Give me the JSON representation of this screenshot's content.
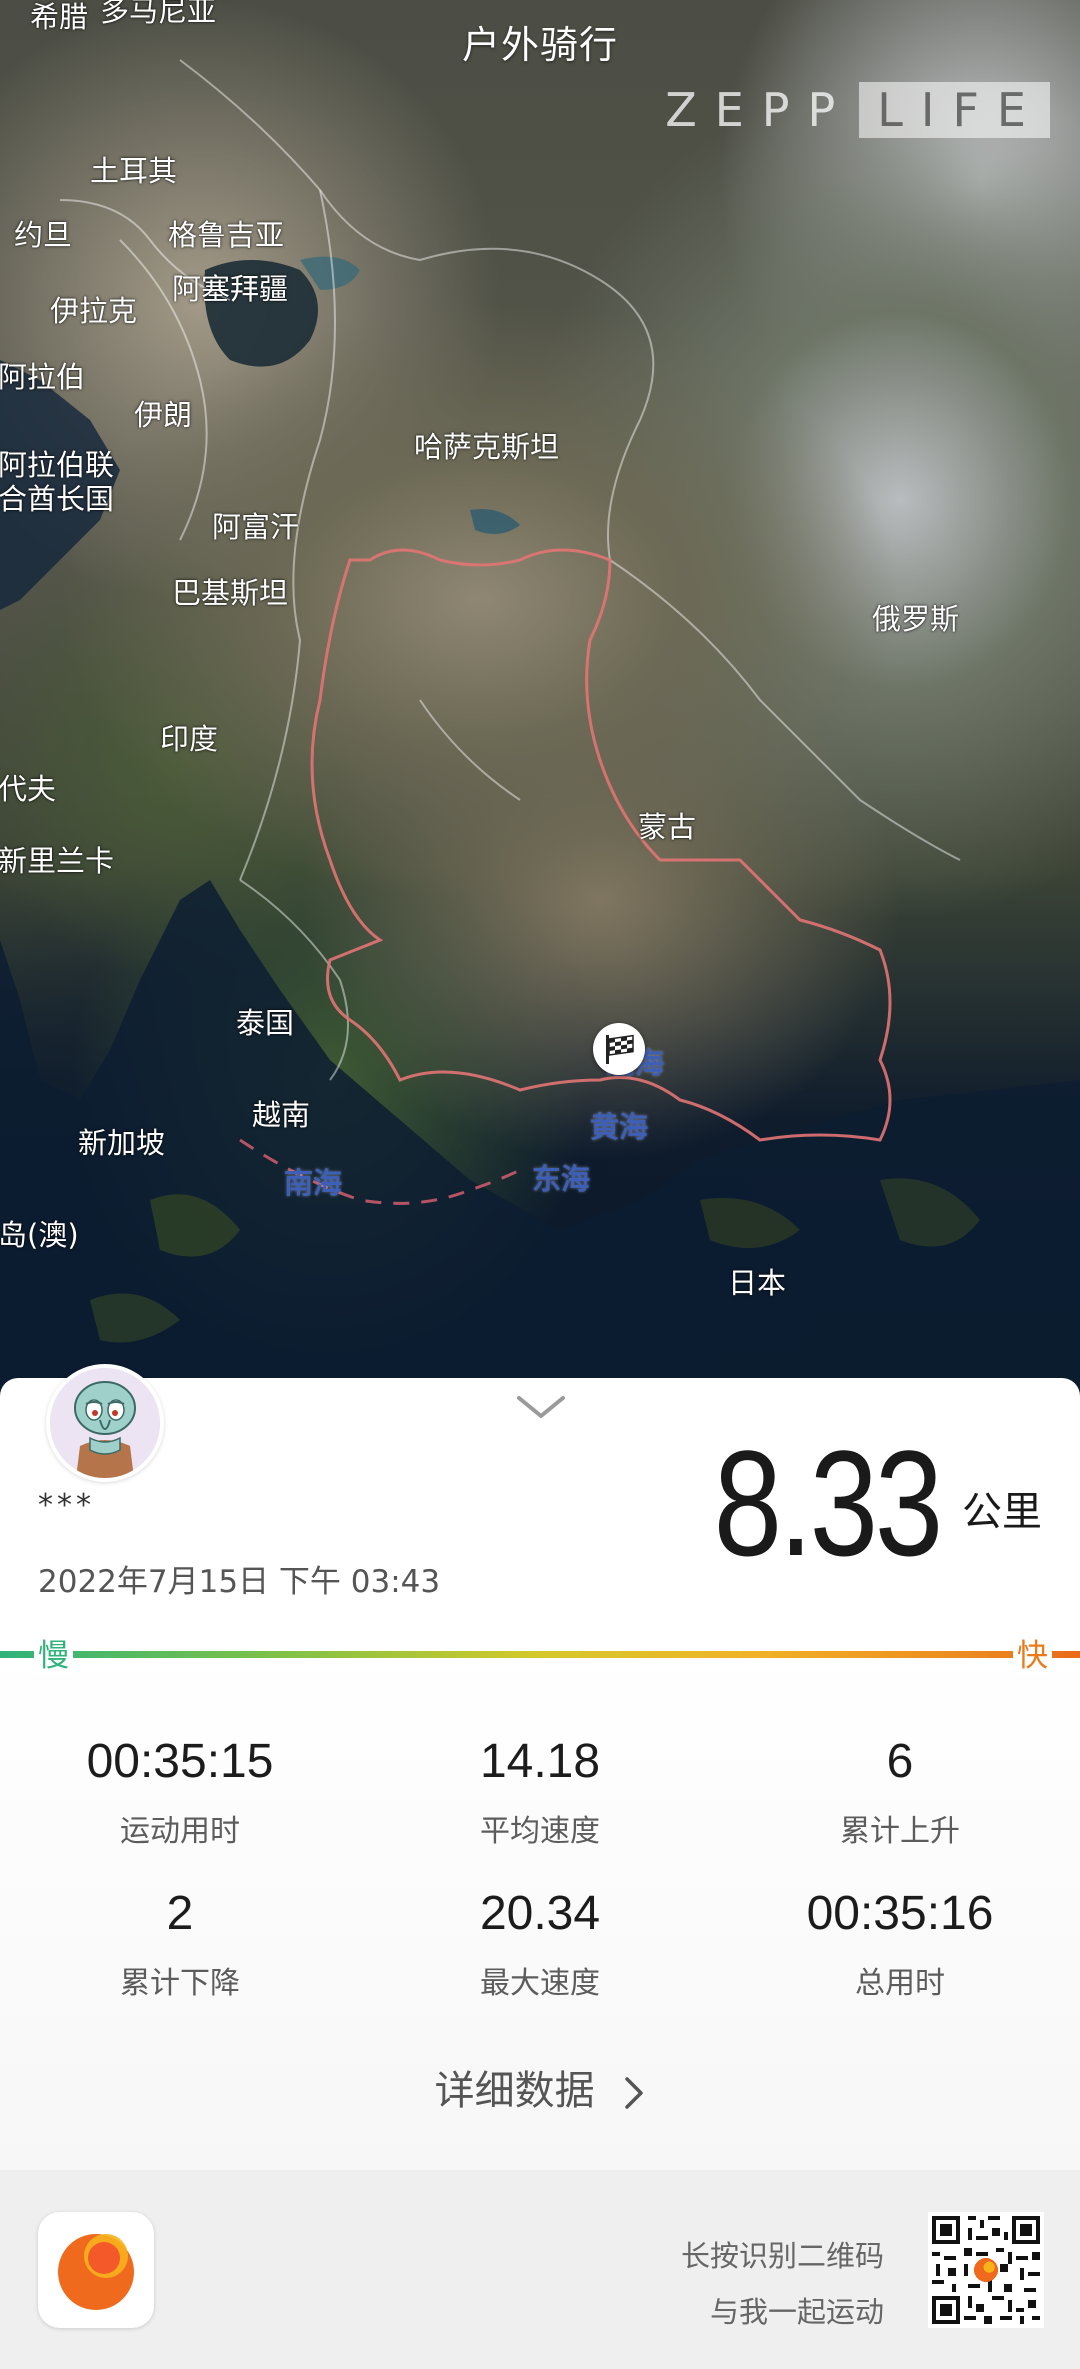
{
  "map": {
    "title": "户外骑行",
    "logo": {
      "left": "ZEPP",
      "right": "LIFE"
    },
    "labels": {
      "greece": "希腊",
      "bulgaria": "多马尼亚",
      "turkey": "土耳其",
      "jordan": "约旦",
      "georgia": "格鲁吉亚",
      "azerbaijan": "阿塞拜疆",
      "iraq": "伊拉克",
      "arabia": "阿拉伯",
      "iran": "伊朗",
      "uae1": "阿拉伯联",
      "uae2": "合酋长国",
      "kazakhstan": "哈萨克斯坦",
      "afghanistan": "阿富汗",
      "pakistan": "巴基斯坦",
      "russia": "俄罗斯",
      "india": "印度",
      "maldives": "代夫",
      "srilanka": "新里兰卡",
      "mongolia": "蒙古",
      "thailand": "泰国",
      "vietnam": "越南",
      "singapore": "新加坡",
      "bohai": "渤海",
      "yellow_sea": "黄海",
      "south_sea": "南海",
      "east_sea": "东海",
      "island": "岛(澳)",
      "japan": "日本"
    },
    "colors": {
      "border": "#e27474",
      "dashed": "#c95a6a"
    }
  },
  "card": {
    "username": "***",
    "datetime": "2022年7月15日 下午 03:43",
    "distance": {
      "value": "8.33",
      "unit": "公里"
    },
    "speed_bar": {
      "slow": "慢",
      "fast": "快"
    },
    "stats": [
      {
        "value": "00:35:15",
        "label": "运动用时"
      },
      {
        "value": "14.18",
        "label": "平均速度"
      },
      {
        "value": "6",
        "label": "累计上升"
      },
      {
        "value": "2",
        "label": "累计下降"
      },
      {
        "value": "20.34",
        "label": "最大速度"
      },
      {
        "value": "00:35:16",
        "label": "总用时"
      }
    ],
    "details_link": "详细数据"
  },
  "footer": {
    "qr_hint_line1": "长按识别二维码",
    "qr_hint_line2": "与我一起运动"
  }
}
